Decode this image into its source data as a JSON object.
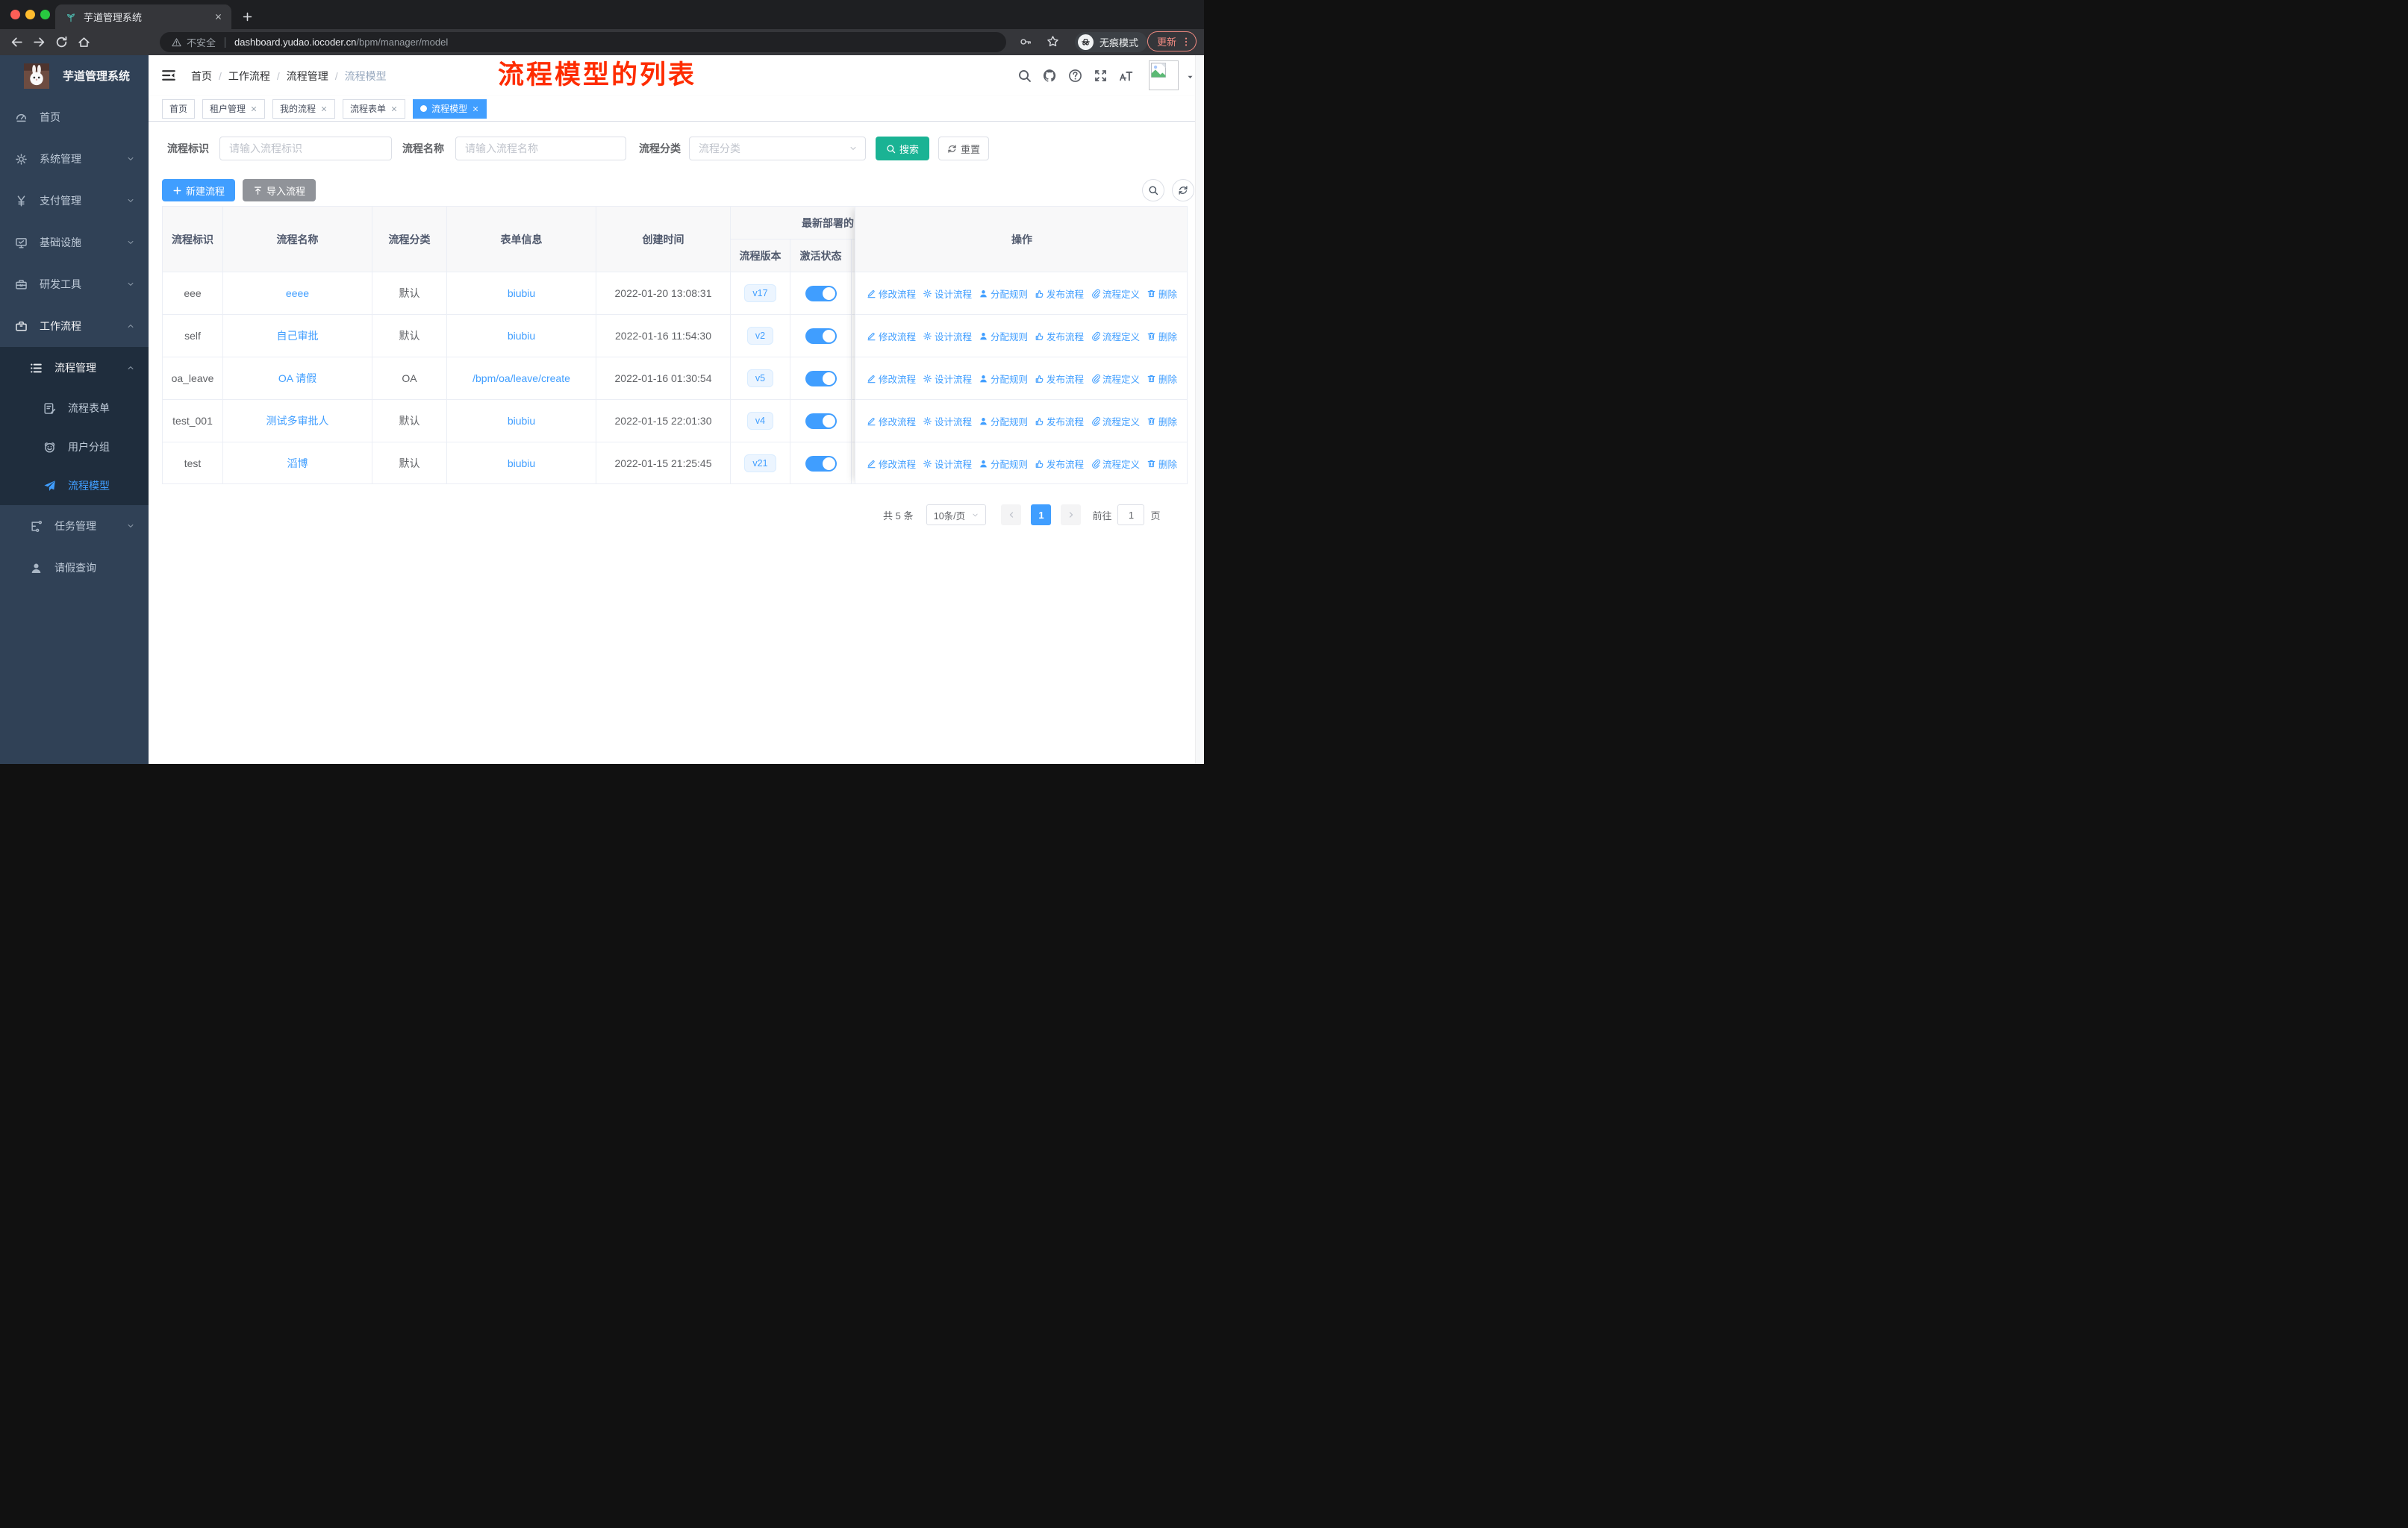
{
  "browser": {
    "tab_title": "芋道管理系统",
    "security": "不安全",
    "domain": "dashboard.yudao.iocoder.cn",
    "path": "/bpm/manager/model",
    "incognito": "无痕模式",
    "update": "更新"
  },
  "sidebar": {
    "app_title": "芋道管理系统",
    "items": [
      {
        "id": "home",
        "label": "首页",
        "icon": "dashboard-icon",
        "level": 1
      },
      {
        "id": "system",
        "label": "系统管理",
        "icon": "gear-icon",
        "level": 1,
        "chevron": "down"
      },
      {
        "id": "payment",
        "label": "支付管理",
        "icon": "yen-icon",
        "level": 1,
        "chevron": "down"
      },
      {
        "id": "infra",
        "label": "基础设施",
        "icon": "monitor-icon",
        "level": 1,
        "chevron": "down"
      },
      {
        "id": "devtools",
        "label": "研发工具",
        "icon": "toolbox-icon",
        "level": 1,
        "chevron": "down"
      },
      {
        "id": "workflow",
        "label": "工作流程",
        "icon": "briefcase-icon",
        "level": 1,
        "chevron": "up",
        "trail": true
      },
      {
        "id": "process-mgmt",
        "label": "流程管理",
        "icon": "list-tree-icon",
        "level": 2,
        "chevron": "up",
        "dark": true,
        "trail": true
      },
      {
        "id": "process-form",
        "label": "流程表单",
        "icon": "form-edit-icon",
        "level": 3,
        "dark": true
      },
      {
        "id": "user-group",
        "label": "用户分组",
        "icon": "user-group-icon",
        "level": 3,
        "dark": true
      },
      {
        "id": "process-model",
        "label": "流程模型",
        "icon": "paper-plane-icon",
        "level": 3,
        "dark": true,
        "active": true
      },
      {
        "id": "task-mgmt",
        "label": "任务管理",
        "icon": "task-flow-icon",
        "level": 2,
        "chevron": "down"
      },
      {
        "id": "leave-query",
        "label": "请假查询",
        "icon": "user-icon",
        "level": 2
      }
    ]
  },
  "header": {
    "breadcrumb": [
      "首页",
      "工作流程",
      "流程管理",
      "流程模型"
    ],
    "annotation": "流程模型的列表"
  },
  "tags_view": {
    "tabs": [
      {
        "label": "首页",
        "closable": false,
        "active": false
      },
      {
        "label": "租户管理",
        "closable": true,
        "active": false
      },
      {
        "label": "我的流程",
        "closable": true,
        "active": false
      },
      {
        "label": "流程表单",
        "closable": true,
        "active": false
      },
      {
        "label": "流程模型",
        "closable": true,
        "active": true
      }
    ]
  },
  "filters": {
    "id_label": "流程标识",
    "id_placeholder": "请输入流程标识",
    "name_label": "流程名称",
    "name_placeholder": "请输入流程名称",
    "category_label": "流程分类",
    "category_placeholder": "流程分类",
    "search_label": "搜索",
    "reset_label": "重置"
  },
  "toolbar": {
    "create_label": "新建流程",
    "import_label": "导入流程"
  },
  "table": {
    "headers": [
      "流程标识",
      "流程名称",
      "流程分类",
      "表单信息",
      "创建时间"
    ],
    "group_header": "最新部署的",
    "sub_headers": [
      "流程版本",
      "激活状态"
    ],
    "actions_header": "操作",
    "rows": [
      {
        "key": "eee",
        "name": "eeee",
        "category": "默认",
        "form": "biubiu",
        "created": "2022-01-20 13:08:31",
        "version": "v17",
        "active": true
      },
      {
        "key": "self",
        "name": "自己审批",
        "category": "默认",
        "form": "biubiu",
        "created": "2022-01-16 11:54:30",
        "version": "v2",
        "active": true
      },
      {
        "key": "oa_leave",
        "name": "OA 请假",
        "category": "OA",
        "form": "/bpm/oa/leave/create",
        "created": "2022-01-16 01:30:54",
        "version": "v5",
        "active": true
      },
      {
        "key": "test_001",
        "name": "测试多审批人",
        "category": "默认",
        "form": "biubiu",
        "created": "2022-01-15 22:01:30",
        "version": "v4",
        "active": true
      },
      {
        "key": "test",
        "name": "滔博",
        "category": "默认",
        "form": "biubiu",
        "created": "2022-01-15 21:25:45",
        "version": "v21",
        "active": true
      }
    ],
    "row_actions": [
      {
        "name": "edit-process-link",
        "icon": "edit-pen-icon",
        "label": "修改流程"
      },
      {
        "name": "design-process-link",
        "icon": "design-gear-icon",
        "label": "设计流程"
      },
      {
        "name": "assign-rule-link",
        "icon": "assign-user-icon",
        "label": "分配规则"
      },
      {
        "name": "publish-process-link",
        "icon": "publish-hand-icon",
        "label": "发布流程"
      },
      {
        "name": "process-definition-link",
        "icon": "paperclip-icon",
        "label": "流程定义"
      },
      {
        "name": "delete-link",
        "icon": "trash-icon",
        "label": "删除"
      }
    ]
  },
  "pagination": {
    "total": "共 5 条",
    "size": "10条/页",
    "page": "1",
    "goto_label": "前往",
    "goto_value": "1",
    "unit": "页"
  },
  "colors": {
    "primary": "#409eff",
    "search_teal": "#1ab394",
    "sidebar_bg": "#304156",
    "sidebar_submenu_bg": "#1f2d3d",
    "annotation_red": "#fe2c00",
    "tag_bg": "#ecf5ff"
  }
}
